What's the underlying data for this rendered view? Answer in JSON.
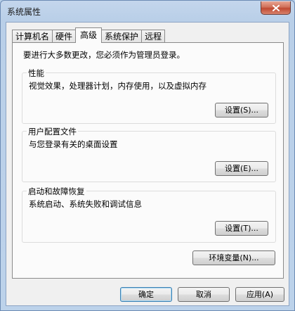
{
  "window": {
    "title": "系统属性"
  },
  "tabs": [
    {
      "label": "计算机名",
      "active": false
    },
    {
      "label": "硬件",
      "active": false
    },
    {
      "label": "高级",
      "active": true
    },
    {
      "label": "系统保护",
      "active": false
    },
    {
      "label": "远程",
      "active": false
    }
  ],
  "advanced": {
    "intro": "要进行大多数更改，您必须作为管理员登录。",
    "performance": {
      "title": "性能",
      "description": "视觉效果，处理器计划，内存使用，以及虚拟内存",
      "settings_label": "设置(S)..."
    },
    "user_profiles": {
      "title": "用户配置文件",
      "description": "与您登录有关的桌面设置",
      "settings_label": "设置(E)..."
    },
    "startup_recovery": {
      "title": "启动和故障恢复",
      "description": "系统启动、系统失败和调试信息",
      "settings_label": "设置(T)..."
    },
    "env_vars_label": "环境变量(N)..."
  },
  "footer": {
    "ok_label": "确定",
    "cancel_label": "取消",
    "apply_label": "应用(A)"
  },
  "colors": {
    "frame": "#b9cfe8",
    "close_button": "#c94a32",
    "default_button_border": "#3c7fb1"
  }
}
